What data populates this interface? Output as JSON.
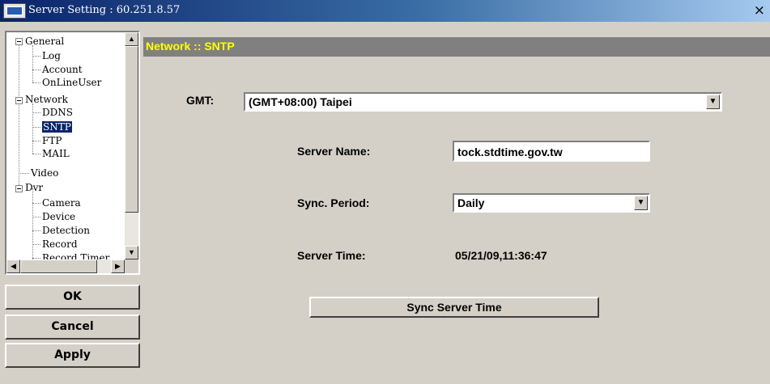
{
  "window": {
    "title": "Server Setting : 60.251.8.57",
    "close_glyph": "×"
  },
  "tree": {
    "items": [
      {
        "label": "General"
      },
      {
        "label": "Log"
      },
      {
        "label": "Account"
      },
      {
        "label": "OnLineUser"
      },
      {
        "label": "Network"
      },
      {
        "label": "DDNS"
      },
      {
        "label": "SNTP",
        "selected": true
      },
      {
        "label": "FTP"
      },
      {
        "label": "MAIL"
      },
      {
        "label": "Video"
      },
      {
        "label": "Dvr"
      },
      {
        "label": "Camera"
      },
      {
        "label": "Device"
      },
      {
        "label": "Detection"
      },
      {
        "label": "Record"
      },
      {
        "label": "Record Timer"
      }
    ]
  },
  "buttons": {
    "ok": "OK",
    "cancel": "Cancel",
    "apply": "Apply"
  },
  "panel": {
    "header": "Network :: SNTP",
    "gmt_label": "GMT:",
    "gmt_value": "(GMT+08:00) Taipei",
    "server_name_label": "Server Name:",
    "server_name_value": "tock.stdtime.gov.tw",
    "sync_period_label": "Sync. Period:",
    "sync_period_value": "Daily",
    "server_time_label": "Server Time:",
    "server_time_value": "05/21/09,11:36:47",
    "sync_button": "Sync Server Time"
  },
  "icons": {
    "app": "computer-icon",
    "dropdown": "chevron-down-icon",
    "scroll_up": "arrow-up-icon",
    "scroll_down": "arrow-down-icon",
    "scroll_left": "arrow-left-icon",
    "scroll_right": "arrow-right-icon"
  },
  "colors": {
    "header_text": "#ffff00",
    "header_bg": "#808080",
    "selection": "#0a246a",
    "title_bar": "#0a246a"
  }
}
